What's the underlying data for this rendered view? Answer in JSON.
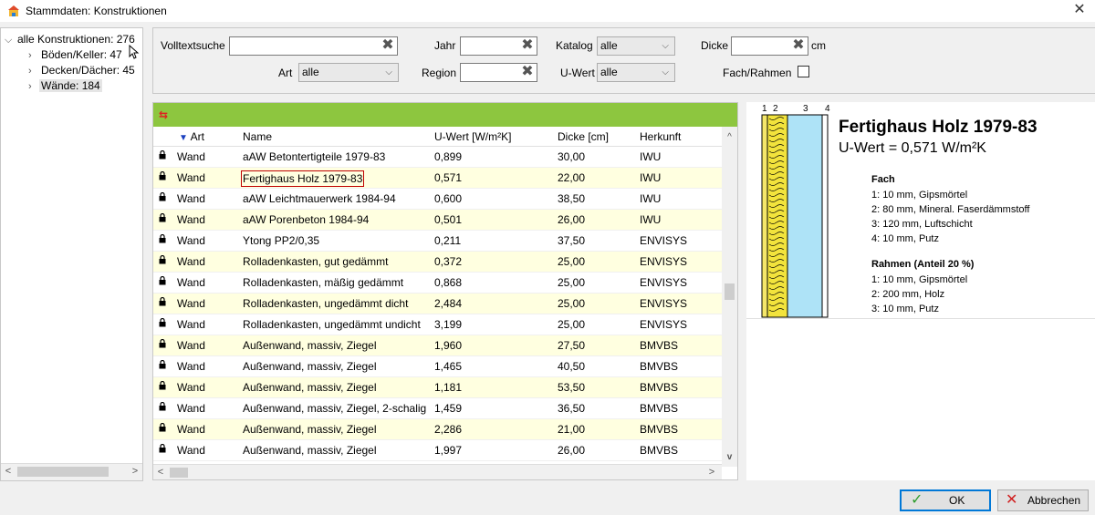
{
  "window": {
    "title": "Stammdaten: Konstruktionen",
    "icons": {
      "app": "house-icon",
      "close": "close-icon"
    }
  },
  "tree": {
    "items": [
      {
        "label": "alle Konstruktionen: 276",
        "expanded": true,
        "level": 0
      },
      {
        "label": "Böden/Keller: 47",
        "expanded": false,
        "level": 1
      },
      {
        "label": "Decken/Dächer: 45",
        "expanded": false,
        "level": 1
      },
      {
        "label": "Wände: 184",
        "expanded": false,
        "level": 1,
        "selected": true
      }
    ]
  },
  "filter": {
    "volltext_label": "Volltextsuche",
    "volltext_value": "",
    "art_label": "Art",
    "art_value": "alle",
    "jahr_label": "Jahr",
    "jahr_value": "",
    "region_label": "Region",
    "region_value": "",
    "katalog_label": "Katalog",
    "katalog_value": "alle",
    "uwert_label": "U-Wert",
    "uwert_value": "alle",
    "dicke_label": "Dicke",
    "dicke_value": "",
    "dicke_unit": "cm",
    "fachrahmen_label": "Fach/Rahmen",
    "fachrahmen_checked": false
  },
  "grid": {
    "columns": [
      "Art",
      "Name",
      "U-Wert [W/m²K]",
      "Dicke [cm]",
      "Herkunft"
    ],
    "sorted_column": "Art",
    "selected_row": 1,
    "rows": [
      {
        "art": "Wand",
        "name": "aAW Betontertigteile 1979-83",
        "uwert": "0,899",
        "dicke": "30,00",
        "herkunft": "IWU"
      },
      {
        "art": "Wand",
        "name": "Fertighaus Holz 1979-83",
        "uwert": "0,571",
        "dicke": "22,00",
        "herkunft": "IWU"
      },
      {
        "art": "Wand",
        "name": "aAW Leichtmauerwerk 1984-94",
        "uwert": "0,600",
        "dicke": "38,50",
        "herkunft": "IWU"
      },
      {
        "art": "Wand",
        "name": "aAW Porenbeton 1984-94",
        "uwert": "0,501",
        "dicke": "26,00",
        "herkunft": "IWU"
      },
      {
        "art": "Wand",
        "name": "Ytong PP2/0,35",
        "uwert": "0,211",
        "dicke": "37,50",
        "herkunft": "ENVISYS"
      },
      {
        "art": "Wand",
        "name": "Rolladenkasten, gut gedämmt",
        "uwert": "0,372",
        "dicke": "25,00",
        "herkunft": "ENVISYS"
      },
      {
        "art": "Wand",
        "name": "Rolladenkasten, mäßig gedämmt",
        "uwert": "0,868",
        "dicke": "25,00",
        "herkunft": "ENVISYS"
      },
      {
        "art": "Wand",
        "name": "Rolladenkasten, ungedämmt dicht",
        "uwert": "2,484",
        "dicke": "25,00",
        "herkunft": "ENVISYS"
      },
      {
        "art": "Wand",
        "name": "Rolladenkasten, ungedämmt undicht",
        "uwert": "3,199",
        "dicke": "25,00",
        "herkunft": "ENVISYS"
      },
      {
        "art": "Wand",
        "name": "Außenwand, massiv, Ziegel",
        "uwert": "1,960",
        "dicke": "27,50",
        "herkunft": "BMVBS"
      },
      {
        "art": "Wand",
        "name": "Außenwand, massiv, Ziegel",
        "uwert": "1,465",
        "dicke": "40,50",
        "herkunft": "BMVBS"
      },
      {
        "art": "Wand",
        "name": "Außenwand, massiv, Ziegel",
        "uwert": "1,181",
        "dicke": "53,50",
        "herkunft": "BMVBS"
      },
      {
        "art": "Wand",
        "name": "Außenwand, massiv, Ziegel, 2-schalig",
        "uwert": "1,459",
        "dicke": "36,50",
        "herkunft": "BMVBS"
      },
      {
        "art": "Wand",
        "name": "Außenwand, massiv, Ziegel",
        "uwert": "2,286",
        "dicke": "21,00",
        "herkunft": "BMVBS"
      },
      {
        "art": "Wand",
        "name": "Außenwand, massiv, Ziegel",
        "uwert": "1,997",
        "dicke": "26,00",
        "herkunft": "BMVBS"
      }
    ]
  },
  "preview": {
    "layer_numbers": [
      "1",
      "2",
      "3",
      "4"
    ],
    "title": "Fertighaus Holz 1979-83",
    "uwert_text": "U-Wert = 0,571 W/m²K",
    "fach_heading": "Fach",
    "fach_items": [
      "1:  10 mm, Gipsmörtel",
      "2:  80 mm, Mineral. Faserdämmstoff",
      "3:  120 mm, Luftschicht",
      "4:  10 mm, Putz"
    ],
    "rahmen_heading": "Rahmen (Anteil 20 %)",
    "rahmen_items": [
      "1:  10 mm, Gipsmörtel",
      "2:  200 mm, Holz",
      "3:  10 mm, Putz"
    ],
    "colors": {
      "gips": "#f5e76a",
      "insulation": "#f2e33c",
      "air": "#aee3f7",
      "putz": "#ffffff",
      "outline": "#000000"
    }
  },
  "buttons": {
    "ok_label": "OK",
    "cancel_label": "Abbrechen"
  },
  "colors": {
    "accent": "#8dc63f",
    "row_alt": "#ffffe0",
    "selection_border": "#c00000",
    "ok_border": "#0078d7"
  }
}
